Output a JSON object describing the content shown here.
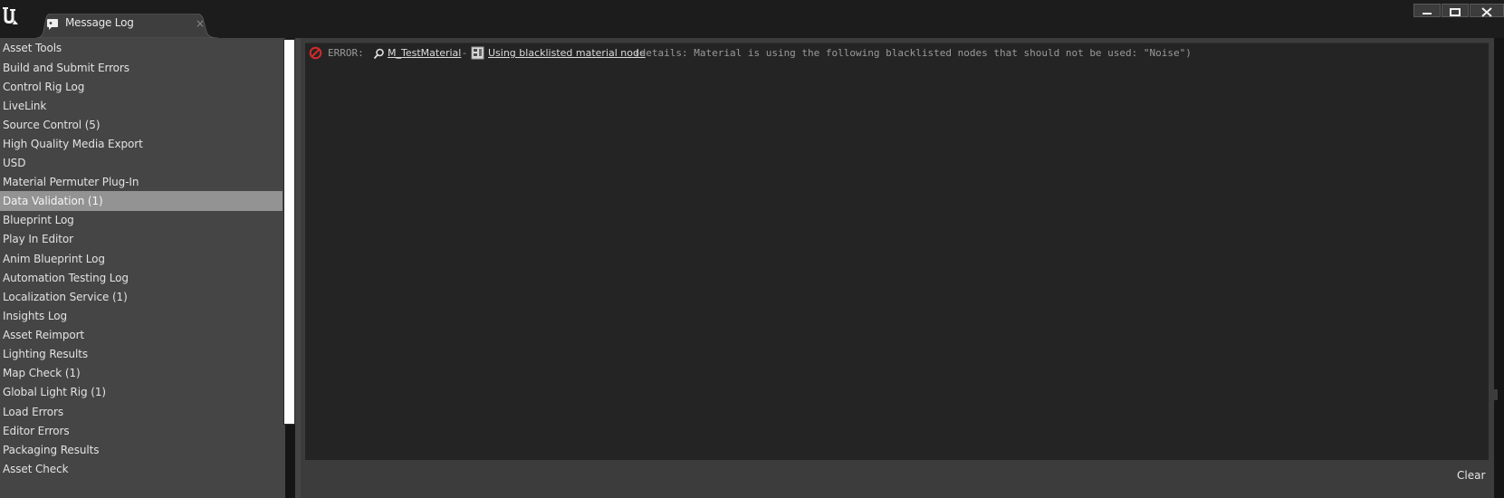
{
  "window": {
    "tab_title": "Message Log",
    "tab_close_glyph": "×",
    "logo": "unreal-engine-logo",
    "controls": [
      "minimize-icon",
      "maximize-icon",
      "close-icon"
    ]
  },
  "categories": [
    {
      "label": "Asset Tools",
      "selected": false
    },
    {
      "label": "Build and Submit Errors",
      "selected": false
    },
    {
      "label": "Control Rig Log",
      "selected": false
    },
    {
      "label": "LiveLink",
      "selected": false
    },
    {
      "label": "Source Control (5)",
      "selected": false
    },
    {
      "label": "High Quality Media Export",
      "selected": false
    },
    {
      "label": "USD",
      "selected": false
    },
    {
      "label": "Material Permuter Plug-In",
      "selected": false
    },
    {
      "label": "Data Validation (1)",
      "selected": true
    },
    {
      "label": "Blueprint Log",
      "selected": false
    },
    {
      "label": "Play In Editor",
      "selected": false
    },
    {
      "label": "Anim Blueprint Log",
      "selected": false
    },
    {
      "label": "Automation Testing Log",
      "selected": false
    },
    {
      "label": "Localization Service (1)",
      "selected": false
    },
    {
      "label": "Insights Log",
      "selected": false
    },
    {
      "label": "Asset Reimport",
      "selected": false
    },
    {
      "label": "Lighting Results",
      "selected": false
    },
    {
      "label": "Map Check (1)",
      "selected": false
    },
    {
      "label": "Global Light Rig (1)",
      "selected": false
    },
    {
      "label": "Load Errors",
      "selected": false
    },
    {
      "label": "Editor Errors",
      "selected": false
    },
    {
      "label": "Packaging Results",
      "selected": false
    },
    {
      "label": "Asset Check",
      "selected": false
    }
  ],
  "log": {
    "entries": [
      {
        "severity": "error",
        "severity_icon": "error-icon",
        "prefix": "ERROR:",
        "asset_icon": "magnifier-icon",
        "asset_link": "M_TestMaterial",
        "separator": "-",
        "node_icon": "material-node-icon",
        "node_link": "Using blacklisted material node",
        "details": "(details: Material is using the following blacklisted nodes that should not be used: \"Noise\")"
      }
    ]
  },
  "footer": {
    "clear_label": "Clear"
  },
  "colors": {
    "error": "#d42a2a",
    "selected_row": "#939393",
    "sidebar_bg": "#454545",
    "log_bg": "#242424"
  }
}
